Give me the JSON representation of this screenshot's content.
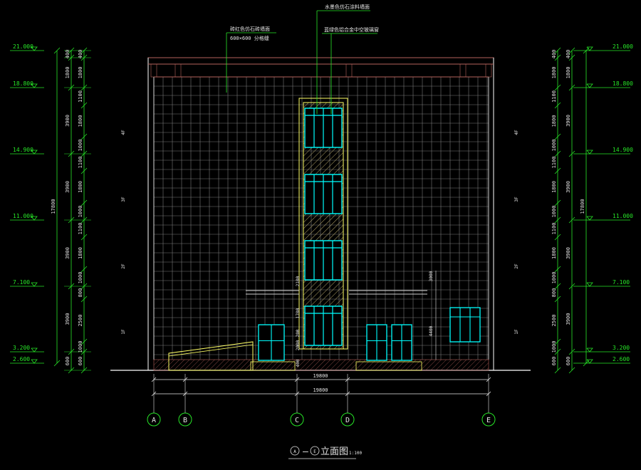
{
  "title": "⑨-⑤立面图",
  "title_display": {
    "prefix": "A",
    "sep": "–",
    "suffix": "E",
    "text": "立面图",
    "scale": "1:100"
  },
  "annotations": {
    "tile_note_1": "砖红色仿石砖墙面",
    "tile_note_2": "600×600 分格缝",
    "top_note": "水墨色仿石涂料墙面",
    "glass_note": "蓝绿色铝合金中空玻璃窗"
  },
  "levels": [
    "21.000",
    "18.800",
    "14.900",
    "11.000",
    "7.100",
    "3.200",
    "2.600"
  ],
  "left_dims_outer": [
    "17800"
  ],
  "left_dims_mid": [
    "400",
    "1800",
    "3900",
    "3900",
    "3900",
    "3900",
    "600"
  ],
  "left_dims_inner": [
    "400",
    "1800",
    "1100",
    "1800",
    "1000",
    "1100",
    "1800",
    "1000",
    "1100",
    "1800",
    "1000",
    "800",
    "2500",
    "1000",
    "600"
  ],
  "right_dims_outer": [
    "17800"
  ],
  "right_dims_mid": [
    "400",
    "1800",
    "3900",
    "3900",
    "3900",
    "3900",
    "600"
  ],
  "right_dims_inner": [
    "400",
    "1800",
    "1100",
    "1800",
    "1000",
    "1100",
    "1800",
    "1000",
    "1100",
    "1800",
    "1000",
    "800",
    "2500",
    "1000",
    "600"
  ],
  "floor_marks": [
    "4F",
    "3F",
    "2F",
    "1F"
  ],
  "bottom_dims": [
    "19800",
    "19800"
  ],
  "axes": [
    "A",
    "B",
    "C",
    "D",
    "E"
  ],
  "center_dims": [
    "3000",
    "4400",
    "400",
    "2100",
    "1700",
    "200",
    "2000"
  ],
  "colors": {
    "level": "#27e627",
    "grid": "#7a7a7a",
    "facade": "#ffffff",
    "parapet": "#b5625b",
    "glass": "#00ffff",
    "frame": "#ffff66",
    "hatch": "#b5a56a",
    "axis_circle": "#27e627"
  }
}
